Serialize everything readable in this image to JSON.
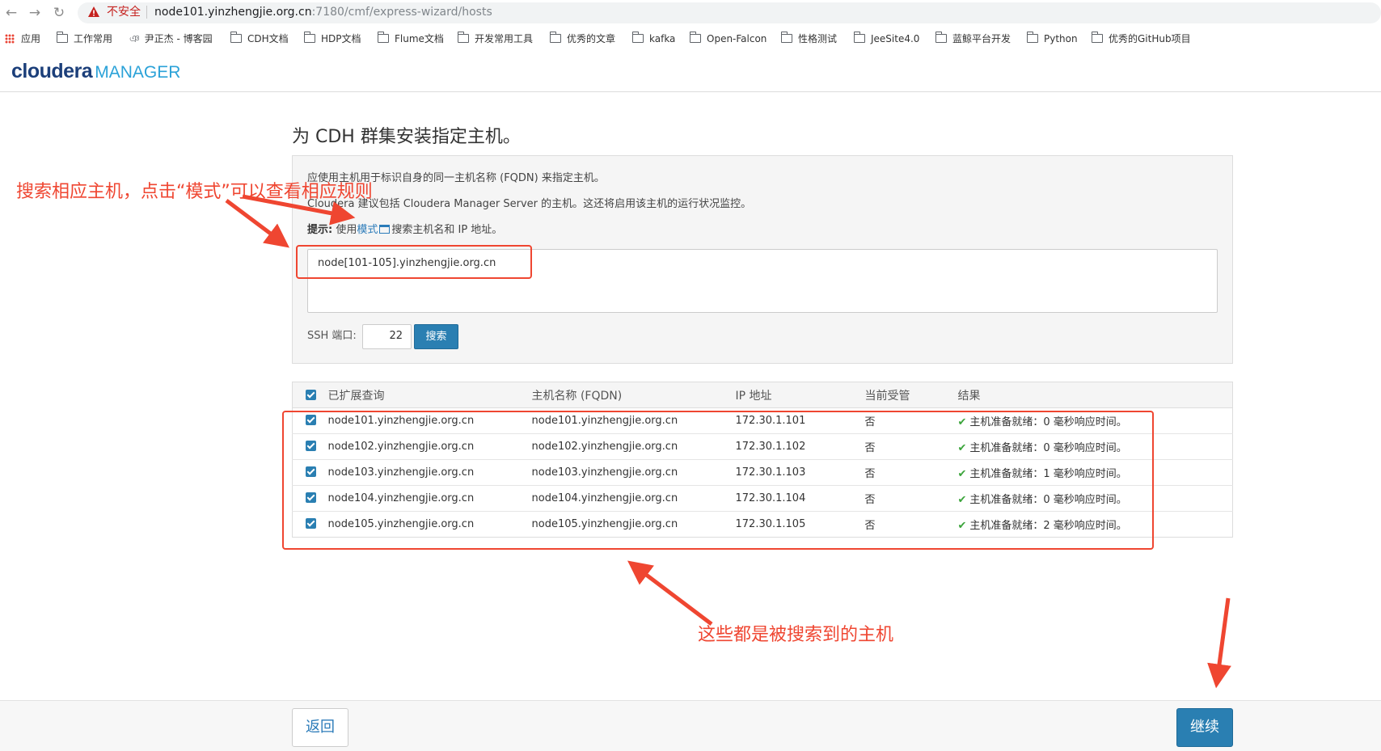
{
  "browser": {
    "security_label": "不安全",
    "url_host": "node101.yinzhengjie.org.cn",
    "url_path": ":7180/cmf/express-wizard/hosts",
    "bookmarks": [
      "应用",
      "工作常用",
      "尹正杰 - 博客园",
      "CDH文档",
      "HDP文档",
      "Flume文档",
      "开发常用工具",
      "优秀的文章",
      "kafka",
      "Open-Falcon",
      "性格测试",
      "JeeSite4.0",
      "蓝鲸平台开发",
      "Python",
      "优秀的GitHub项目"
    ]
  },
  "header": {
    "logo_main": "cloudera",
    "logo_sub": "MANAGER"
  },
  "page": {
    "title": "为 CDH 群集安装指定主机。",
    "line1": "应使用主机用于标识自身的同一主机名称 (FQDN) 来指定主机。",
    "line2": "Cloudera 建议包括 Cloudera Manager Server 的主机。这还将启用该主机的运行状况监控。",
    "hint_label": "提示:",
    "hint_pre": " 使用",
    "hint_link": "模式",
    "hint_post": "搜索主机名和 IP 地址。",
    "host_pattern": "node[101-105].yinzhengjie.org.cn",
    "ssh_label": "SSH 端口:",
    "ssh_port": "22",
    "search_button": "搜索"
  },
  "table": {
    "headers": [
      "已扩展查询",
      "主机名称 (FQDN)",
      "IP 地址",
      "当前受管",
      "结果"
    ],
    "rows": [
      {
        "query": "node101.yinzhengjie.org.cn",
        "fqdn": "node101.yinzhengjie.org.cn",
        "ip": "172.30.1.101",
        "managed": "否",
        "result": "主机准备就绪：0 毫秒响应时间。"
      },
      {
        "query": "node102.yinzhengjie.org.cn",
        "fqdn": "node102.yinzhengjie.org.cn",
        "ip": "172.30.1.102",
        "managed": "否",
        "result": "主机准备就绪：0 毫秒响应时间。"
      },
      {
        "query": "node103.yinzhengjie.org.cn",
        "fqdn": "node103.yinzhengjie.org.cn",
        "ip": "172.30.1.103",
        "managed": "否",
        "result": "主机准备就绪：1 毫秒响应时间。"
      },
      {
        "query": "node104.yinzhengjie.org.cn",
        "fqdn": "node104.yinzhengjie.org.cn",
        "ip": "172.30.1.104",
        "managed": "否",
        "result": "主机准备就绪：0 毫秒响应时间。"
      },
      {
        "query": "node105.yinzhengjie.org.cn",
        "fqdn": "node105.yinzhengjie.org.cn",
        "ip": "172.30.1.105",
        "managed": "否",
        "result": "主机准备就绪：2 毫秒响应时间。"
      }
    ]
  },
  "annotations": {
    "search_note": "搜索相应主机，点击“模式”可以查看相应规则",
    "hosts_note": "这些都是被搜索到的主机"
  },
  "footer": {
    "back_button": "返回",
    "continue_button": "继续"
  },
  "colors": {
    "accent": "#2a7fb2",
    "annotation": "#ef4631",
    "ok": "#3aa43a"
  }
}
